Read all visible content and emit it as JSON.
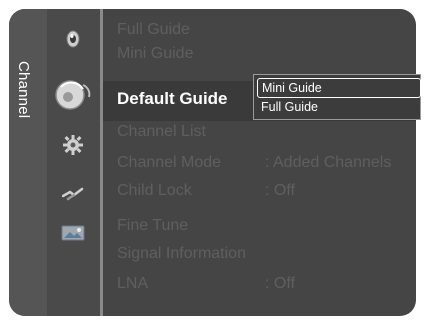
{
  "sidebar": {
    "tab_label": "Channel"
  },
  "icons": [
    "disc-icon",
    "satellite-dish-icon",
    "gear-icon",
    "plug-icon",
    "image-icon"
  ],
  "menu": {
    "items": [
      {
        "label": "Full Guide",
        "value": ""
      },
      {
        "label": "Mini Guide",
        "value": ""
      },
      {
        "label": "Default Guide",
        "value": ""
      },
      {
        "label": "Channel List",
        "value": ""
      },
      {
        "label": "Channel Mode",
        "value": ": Added Channels"
      },
      {
        "label": "Child Lock",
        "value": ": Off"
      },
      {
        "label": "Fine Tune",
        "value": ""
      },
      {
        "label": "Signal Information",
        "value": ""
      },
      {
        "label": "LNA",
        "value": ": Off"
      }
    ]
  },
  "dropdown": {
    "options": [
      "Mini Guide",
      "Full Guide"
    ],
    "selected": "Mini Guide"
  },
  "colors": {
    "background": "#454545",
    "text_active": "#ffffff",
    "text_dim": "#5f5f5f"
  }
}
